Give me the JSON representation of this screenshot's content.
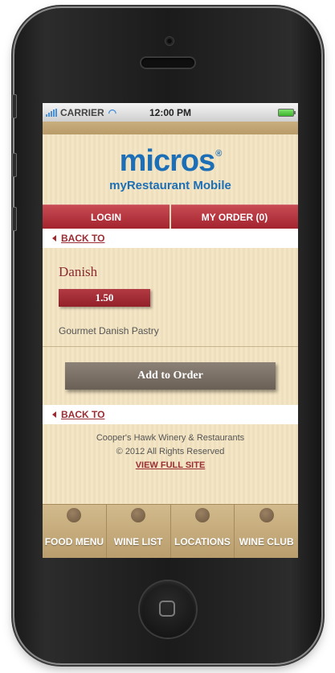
{
  "status_bar": {
    "carrier": "CARRIER",
    "time": "12:00 PM"
  },
  "header": {
    "logo_text": "micros",
    "logo_reg": "®",
    "subtitle": "myRestaurant Mobile"
  },
  "nav": {
    "login_label": "LOGIN",
    "order_label": "MY ORDER (0)"
  },
  "back_link_label": "BACK TO",
  "item": {
    "name": "Danish",
    "price": "1.50",
    "description": "Gourmet Danish Pastry"
  },
  "add_button_label": "Add to Order",
  "footer": {
    "company": "Cooper's Hawk Winery & Restaurants",
    "copyright": "© 2012 All Rights Reserved",
    "full_site_link": "VIEW FULL SITE"
  },
  "tabbar": {
    "items": [
      {
        "label": "FOOD MENU"
      },
      {
        "label": "WINE LIST"
      },
      {
        "label": "LOCATIONS"
      },
      {
        "label": "WINE CLUB"
      }
    ]
  },
  "colors": {
    "brand_blue": "#1c6fb6",
    "accent_red": "#a3242e",
    "background_tan": "#efe0bd"
  }
}
